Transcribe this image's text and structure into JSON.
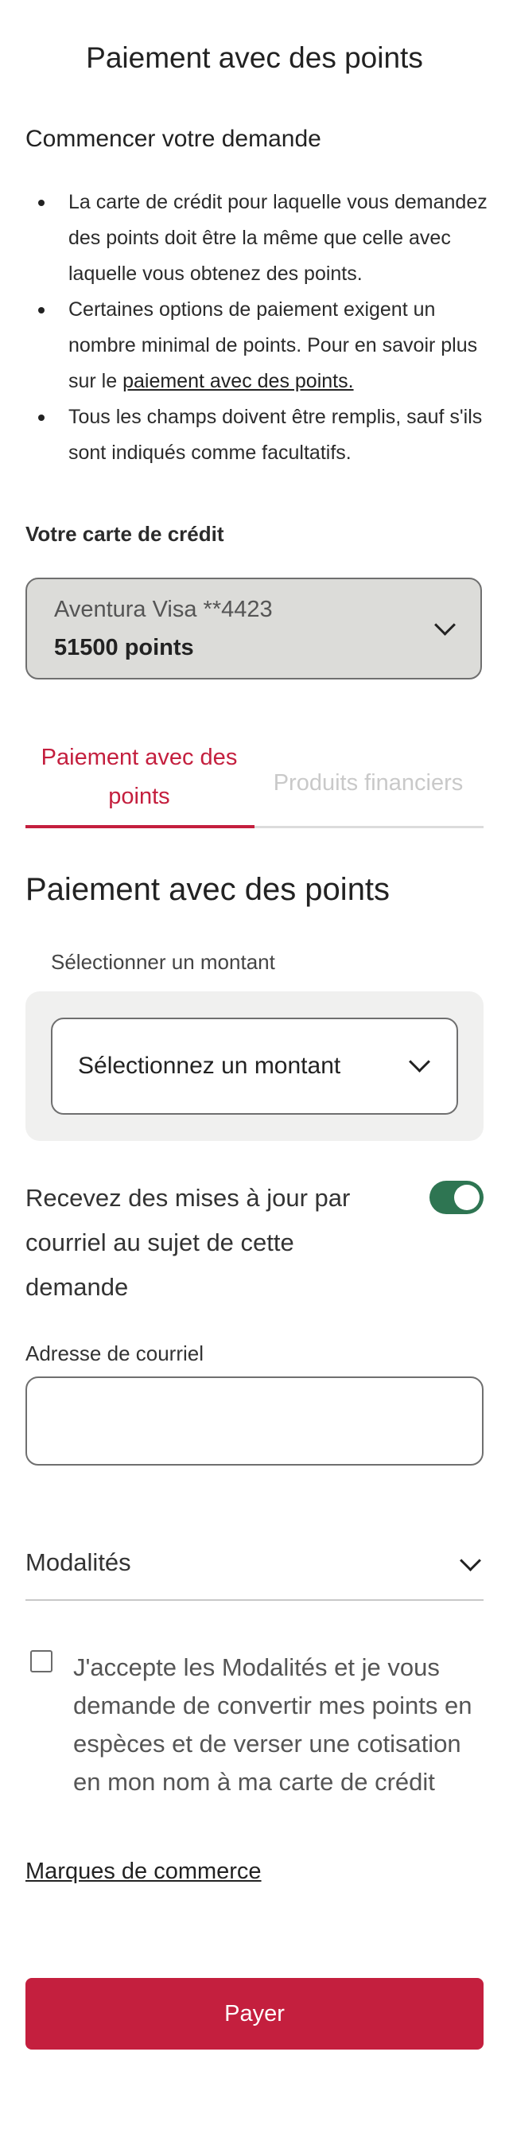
{
  "page": {
    "title": "Paiement avec des points"
  },
  "intro": {
    "heading": "Commencer votre demande",
    "bullets": [
      {
        "text": "La carte de crédit pour laquelle vous demandez des points doit être la même que celle avec laquelle vous obtenez des points."
      },
      {
        "text_before": "Certaines options de paiement exigent un nombre minimal de points. Pour en savoir plus sur le ",
        "link": "paiement avec des points."
      },
      {
        "text": "Tous les champs doivent être remplis, sauf s'ils sont indiqués comme facultatifs."
      }
    ]
  },
  "card": {
    "label": "Votre carte de crédit",
    "selected_name": "Aventura Visa **4423",
    "selected_points": "51500 points"
  },
  "tabs": [
    {
      "label": "Paiement avec des points",
      "active": true
    },
    {
      "label": "Produits financiers",
      "active": false
    }
  ],
  "form": {
    "section_title": "Paiement avec des points",
    "amount_label": "Sélectionner un montant",
    "amount_selected": "Sélectionnez un montant",
    "updates_label": "Recevez des mises à jour par courriel au sujet de cette demande",
    "updates_enabled": true,
    "email_label": "Adresse de courriel",
    "email_value": ""
  },
  "terms": {
    "title": "Modalités",
    "accept_text": "J'accepte les Modalités et je vous demande de convertir mes points en espèces et de verser une cotisation en mon nom à ma carte de crédit",
    "accepted": false
  },
  "trademarks_link": "Marques de commerce",
  "pay_button": "Payer",
  "colors": {
    "brand": "#c41f3e",
    "toggle_on": "#2e7552",
    "select_bg": "#dcdcd9",
    "panel_bg": "#f0f0ef"
  },
  "icons": [
    "chevron-down-icon",
    "bullet-icon",
    "toggle-switch",
    "checkbox"
  ]
}
